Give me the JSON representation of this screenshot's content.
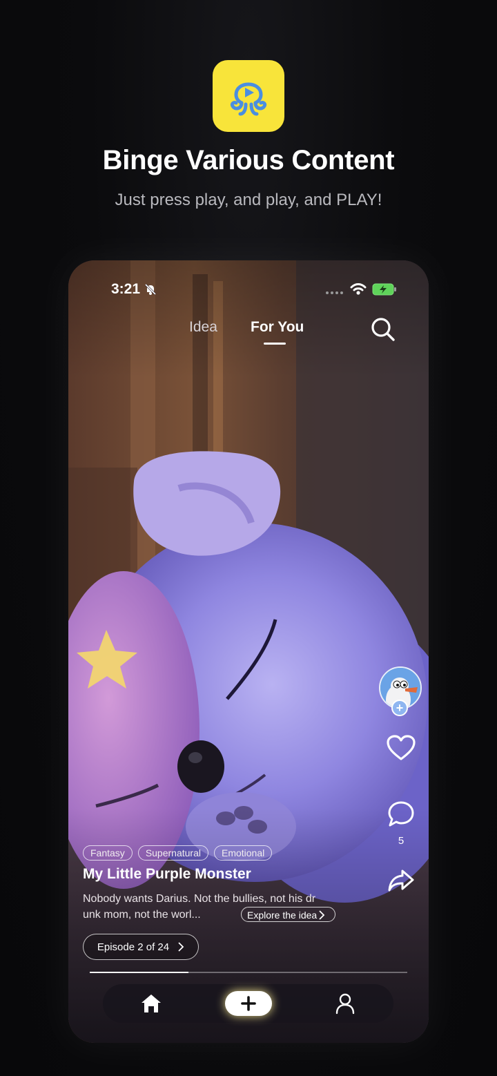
{
  "promo": {
    "headline": "Binge Various Content",
    "subline": "Just press play, and play, and PLAY!",
    "app_icon_color": "#f8e43a",
    "app_icon_glyph_color": "#4a8ee0"
  },
  "status_bar": {
    "time": "3:21"
  },
  "top_tabs": {
    "idea": "Idea",
    "for_you": "For You",
    "active": "For You"
  },
  "side_actions": {
    "comment_count": "5"
  },
  "video": {
    "tags": [
      "Fantasy",
      "Supernatural",
      "Emotional"
    ],
    "title": "My Little Purple Monster",
    "description_line1": "Nobody wants Darius. Not the bullies, not his dr",
    "description_line2": "unk mom, not the worl...",
    "explore_label": "Explore the idea",
    "episode_label": "Episode 2 of 24",
    "playback_progress": 0.31
  },
  "bottom_nav": {
    "items": [
      "home-icon",
      "create-plus-icon",
      "profile-icon"
    ]
  }
}
